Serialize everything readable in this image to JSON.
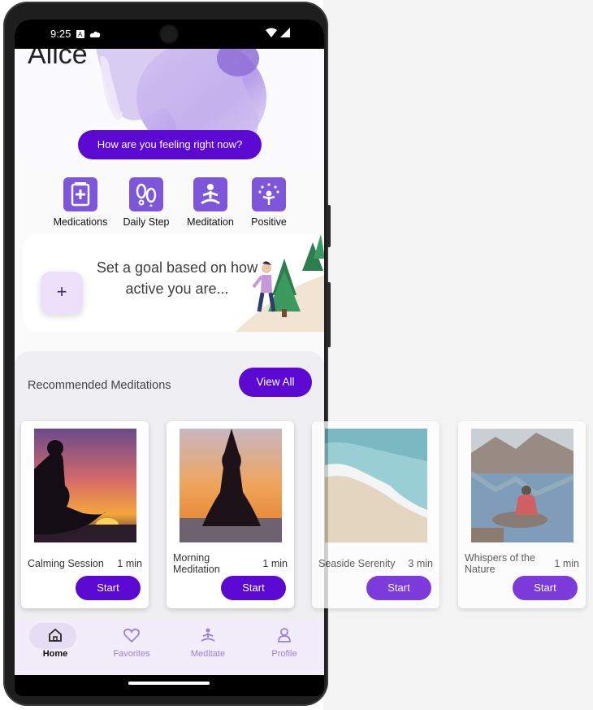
{
  "status_bar": {
    "time": "9:25"
  },
  "hero": {
    "user_name": "Alice",
    "feeling_button": "How are you feeling right now?"
  },
  "quick_actions": [
    {
      "label": "Medications",
      "icon": "medication-icon"
    },
    {
      "label": "Daily Step",
      "icon": "footsteps-icon"
    },
    {
      "label": "Meditation",
      "icon": "meditation-icon"
    },
    {
      "label": "Positive",
      "icon": "positive-icon"
    }
  ],
  "goal_card": {
    "plus": "+",
    "text": "Set a goal based on how active you are..."
  },
  "recommended": {
    "title": "Recommended Meditations",
    "view_all": "View All",
    "items": [
      {
        "title": "Calming Session",
        "duration": "1 min",
        "start": "Start"
      },
      {
        "title": "Morning Meditation",
        "duration": "1 min",
        "start": "Start"
      },
      {
        "title": "Seaside Serenity",
        "duration": "3 min",
        "start": "Start"
      },
      {
        "title": "Whispers of the Nature",
        "duration": "1 min",
        "start": "Start"
      }
    ]
  },
  "bottom_nav": [
    {
      "label": "Home",
      "icon": "home-icon",
      "active": true
    },
    {
      "label": "Favorites",
      "icon": "heart-icon",
      "active": false
    },
    {
      "label": "Meditate",
      "icon": "meditate-icon",
      "active": false
    },
    {
      "label": "Profile",
      "icon": "profile-icon",
      "active": false
    }
  ],
  "colors": {
    "primary": "#5b08d3",
    "icon_bg": "#7d56d9",
    "nav_bg": "#f3ecfa"
  }
}
